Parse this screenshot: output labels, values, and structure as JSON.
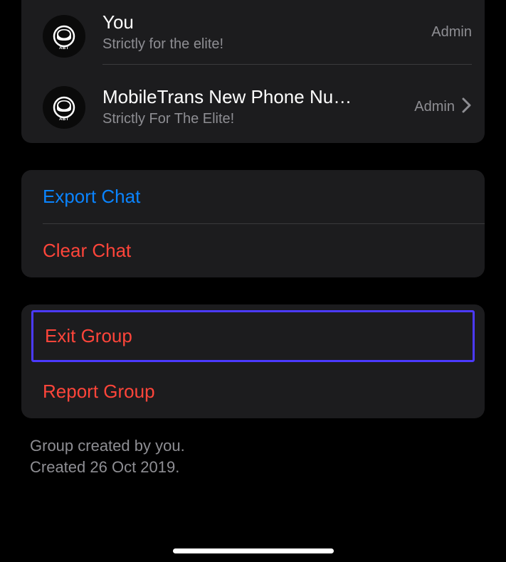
{
  "participants": [
    {
      "name": "You",
      "status": "Strictly for the elite!",
      "role": "Admin",
      "avatar_label": "ABT",
      "has_chevron": false
    },
    {
      "name": "MobileTrans New Phone Nu…",
      "status": "Strictly For The Elite!",
      "role": "Admin",
      "avatar_label": "ABT",
      "has_chevron": true
    }
  ],
  "chat_actions": {
    "export": "Export Chat",
    "clear": "Clear Chat"
  },
  "group_actions": {
    "exit": "Exit Group",
    "report": "Report Group"
  },
  "footer": {
    "line1": "Group created by you.",
    "line2": "Created 26 Oct 2019."
  },
  "colors": {
    "bg": "#000000",
    "card": "#1c1c1e",
    "text_primary": "#ffffff",
    "text_secondary": "#8e8e93",
    "accent_blue": "#0a84ff",
    "accent_red": "#ff453a",
    "highlight_border": "#4b3aff"
  }
}
